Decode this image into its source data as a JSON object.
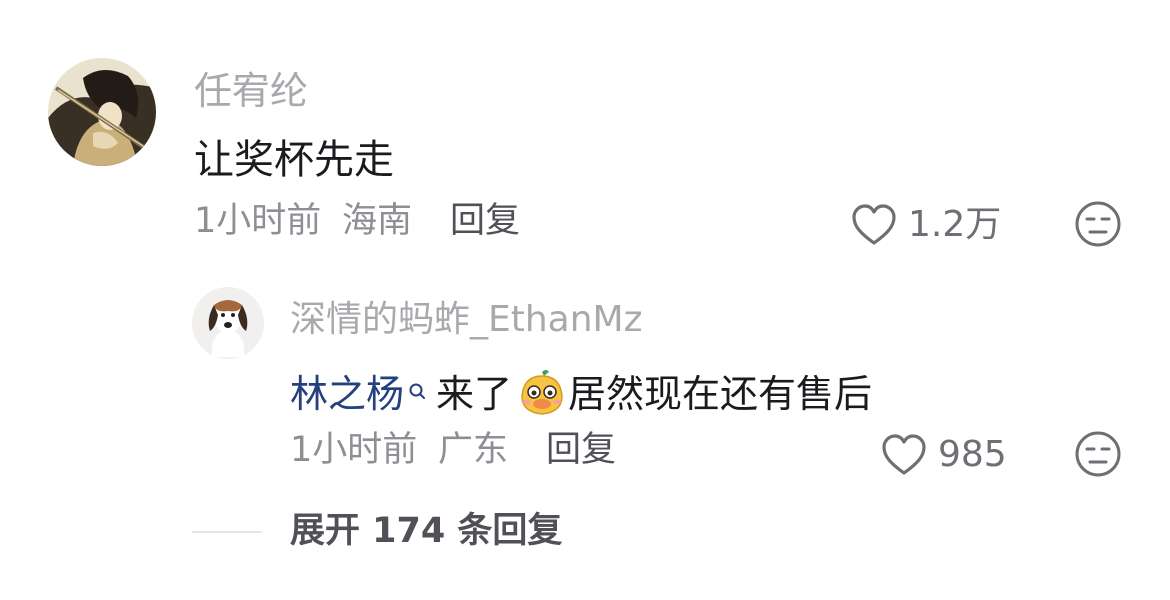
{
  "comment": {
    "username": "任宥纶",
    "text": "让奖杯先走",
    "time": "1小时前",
    "location": "海南",
    "reply_label": "回复",
    "like_count": "1.2万",
    "avatar_icon": "anime-avatar",
    "dislike_icon": "unamused-face-icon"
  },
  "reply": {
    "username": "深情的蚂蚱_EthanMz",
    "mention": "林之杨",
    "text_before_emoji": "来了",
    "text_after_emoji": "居然现在还有售后",
    "emoji_icon": "duck-emoji-icon",
    "time": "1小时前",
    "location": "广东",
    "reply_label": "回复",
    "like_count": "985",
    "avatar_icon": "beagle-avatar",
    "dislike_icon": "unamused-face-icon"
  },
  "expand": {
    "label": "展开 174 条回复"
  },
  "colors": {
    "username": "#a8a9ad",
    "text": "#1b1b1f",
    "meta": "#8e8f94",
    "mention": "#24407f",
    "icon": "#6e6f74"
  }
}
